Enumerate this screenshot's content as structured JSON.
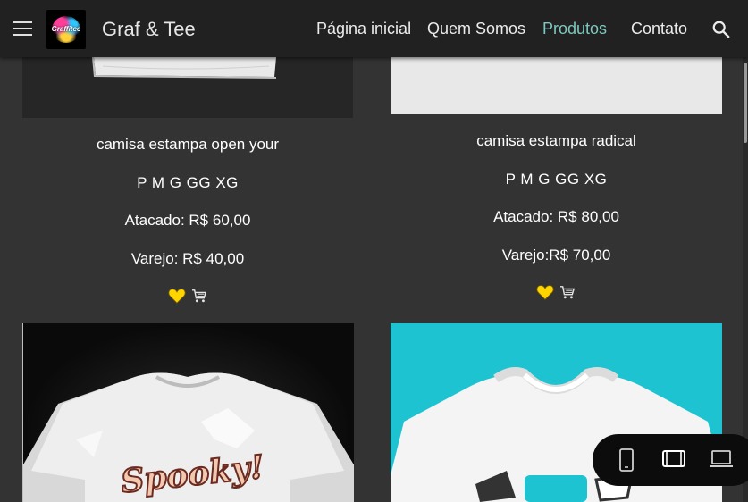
{
  "header": {
    "site_title": "Graf & Tee",
    "logo_text": "Graffitee",
    "nav": [
      {
        "label": "Página inicial",
        "active": false
      },
      {
        "label": "Quem Somos",
        "active": false
      },
      {
        "label": "Produtos",
        "active": true
      },
      {
        "label": "Contato",
        "active": false
      }
    ],
    "active_color": "#7ec8c0"
  },
  "products": [
    {
      "name": "camisa estampa open your",
      "sizes": "P  M  G  GG  XG",
      "wholesale": "Atacado: R$ 60,00",
      "retail": "Varejo: R$ 40,00"
    },
    {
      "name": "camisa estampa radical",
      "sizes": "P  M  G  GG  XG",
      "wholesale": "Atacado: R$ 80,00",
      "retail": "Varejo:R$ 70,00"
    }
  ],
  "next_products": [
    {
      "print_text": "Spooky!",
      "bg": "#000000"
    },
    {
      "print_text": "",
      "bg": "#1ec3d2"
    }
  ],
  "icons": {
    "heart_color": "#ffd500",
    "cart": "cart-icon",
    "device_options": [
      "mobile-icon",
      "tablet-icon",
      "laptop-icon"
    ]
  }
}
